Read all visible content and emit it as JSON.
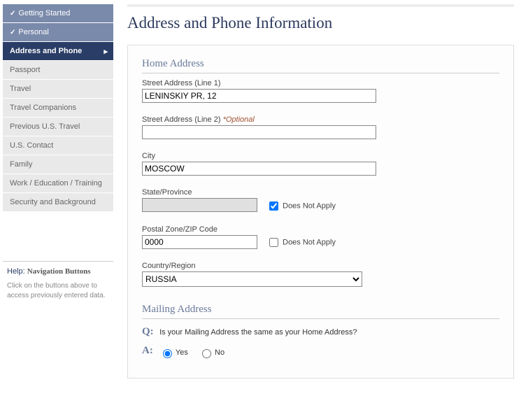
{
  "sidebar": {
    "items": [
      {
        "label": "Getting Started",
        "state": "completed"
      },
      {
        "label": "Personal",
        "state": "completed"
      },
      {
        "label": "Address and Phone",
        "state": "active"
      },
      {
        "label": "Passport",
        "state": ""
      },
      {
        "label": "Travel",
        "state": ""
      },
      {
        "label": "Travel Companions",
        "state": ""
      },
      {
        "label": "Previous U.S. Travel",
        "state": ""
      },
      {
        "label": "U.S. Contact",
        "state": ""
      },
      {
        "label": "Family",
        "state": ""
      },
      {
        "label": "Work / Education / Training",
        "state": ""
      },
      {
        "label": "Security and Background",
        "state": ""
      }
    ],
    "help_title": "Help:",
    "help_label": "Navigation Buttons",
    "help_text": "Click on the buttons above to access previously entered data."
  },
  "page_title": "Address and Phone Information",
  "home_address": {
    "section_title": "Home Address",
    "street1_label": "Street Address (Line 1)",
    "street1_value": "LENINSKIY PR, 12",
    "street2_label": "Street Address (Line 2)",
    "street2_optional": "*Optional",
    "street2_value": "",
    "city_label": "City",
    "city_value": "MOSCOW",
    "state_label": "State/Province",
    "state_value": "",
    "state_dna_label": "Does Not Apply",
    "state_dna_checked": true,
    "zip_label": "Postal Zone/ZIP Code",
    "zip_value": "0000",
    "zip_dna_label": "Does Not Apply",
    "zip_dna_checked": false,
    "country_label": "Country/Region",
    "country_value": "RUSSIA"
  },
  "mailing_address": {
    "section_title": "Mailing Address",
    "q_label": "Q:",
    "q_text": "Is your Mailing Address the same as your Home Address?",
    "a_label": "A:",
    "yes_label": "Yes",
    "no_label": "No",
    "selected": "Yes"
  }
}
